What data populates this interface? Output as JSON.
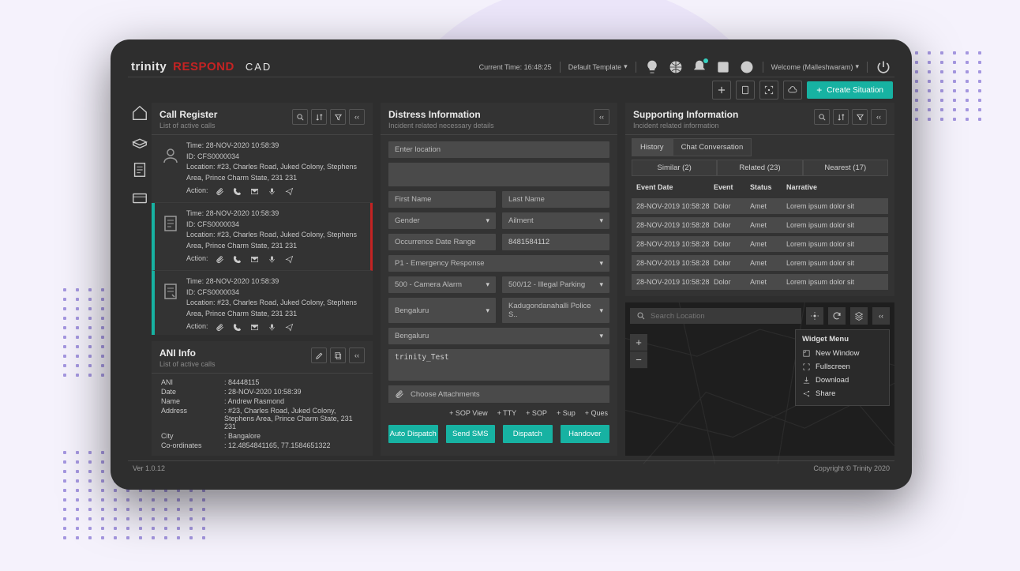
{
  "brand": {
    "part1": "trinity",
    "part2": "RESPOND",
    "part3": "CAD"
  },
  "topbar": {
    "current_time_label": "Current Time: 16:48:25",
    "template_label": "Default Template",
    "welcome": "Welcome (Malleshwaram)"
  },
  "secbar": {
    "create_label": "Create Situation"
  },
  "sidenav": {
    "items": [
      "home",
      "scan",
      "document",
      "card"
    ]
  },
  "call_register": {
    "title": "Call Register",
    "subtitle": "List of active calls",
    "cards": [
      {
        "time": "Time: 28-NOV-2020 10:58:39",
        "id": "ID: CFS0000034",
        "loc": "Location: #23, Charles Road, Juked Colony, Stephens Area, Prince Charm State, 231 231",
        "action_label": "Action:"
      },
      {
        "time": "Time: 28-NOV-2020 10:58:39",
        "id": "ID: CFS0000034",
        "loc": "Location: #23, Charles Road, Juked Colony, Stephens Area, Prince Charm State, 231 231",
        "action_label": "Action:"
      },
      {
        "time": "Time: 28-NOV-2020 10:58:39",
        "id": "ID: CFS0000034",
        "loc": "Location: #23, Charles Road, Juked Colony, Stephens Area, Prince Charm State, 231 231",
        "action_label": "Action:"
      }
    ]
  },
  "ani": {
    "title": "ANI Info",
    "subtitle": "List of active calls",
    "fields": {
      "ani_k": "ANI",
      "ani_v": ": 84448115",
      "date_k": "Date",
      "date_v": ": 28-NOV-2020 10:58:39",
      "name_k": "Name",
      "name_v": ": Andrew Rasmond",
      "addr_k": "Address",
      "addr_v": ": #23, Charles Road, Juked Colony, Stephens Area, Prince Charm State, 231 231",
      "city_k": "City",
      "city_v": ": Bangalore",
      "coord_k": "Co-ordinates",
      "coord_v": ": 12.4854841165, 77.1584651322"
    }
  },
  "distress": {
    "title": "Distress Information",
    "subtitle": "Incident related necessary details",
    "location_ph": "Enter location",
    "first_name_ph": "First Name",
    "last_name_ph": "Last Name",
    "gender": "Gender",
    "ailment": "Ailment",
    "odr_ph": "Occurrence Date Range",
    "phone": "8481584112",
    "priority": "P1 - Emergency Response",
    "evt1": "500 - Camera Alarm",
    "evt2": "500/12 - Illegal Parking",
    "city": "Bengaluru",
    "station": "Kadugondanahalli Police S..",
    "area": "Bengaluru",
    "notes": "trinity_Test",
    "attach_label": "Choose Attachments",
    "links": {
      "sopview": "+ SOP View",
      "tty": "+ TTY",
      "sop": "+ SOP",
      "sup": "+ Sup",
      "ques": "+ Ques"
    },
    "buttons": {
      "autodispatch": "Auto Dispatch",
      "sms": "Send SMS",
      "dispatch": "Dispatch",
      "handover": "Handover"
    }
  },
  "supporting": {
    "title": "Supporting Information",
    "subtitle": "Incident related information",
    "tabs": {
      "history": "History",
      "chat": "Chat Conversation"
    },
    "subtabs": {
      "similar": "Similar (2)",
      "related": "Related (23)",
      "nearest": "Nearest (17)"
    },
    "columns": {
      "c1": "Event Date",
      "c2": "Event",
      "c3": "Status",
      "c4": "Narrative"
    },
    "rows": [
      {
        "d": "28-NOV-2019 10:58:28",
        "e": "Dolor",
        "s": "Amet",
        "n": "Lorem ipsum dolor sit"
      },
      {
        "d": "28-NOV-2019 10:58:28",
        "e": "Dolor",
        "s": "Amet",
        "n": "Lorem ipsum dolor sit"
      },
      {
        "d": "28-NOV-2019 10:58:28",
        "e": "Dolor",
        "s": "Amet",
        "n": "Lorem ipsum dolor sit"
      },
      {
        "d": "28-NOV-2019 10:58:28",
        "e": "Dolor",
        "s": "Amet",
        "n": "Lorem ipsum dolor sit"
      },
      {
        "d": "28-NOV-2019 10:58:28",
        "e": "Dolor",
        "s": "Amet",
        "n": "Lorem ipsum dolor sit"
      }
    ]
  },
  "map": {
    "search_ph": "Search Location",
    "widget": {
      "title": "Widget Menu",
      "items": {
        "nw": "New Window",
        "fs": "Fullscreen",
        "dl": "Download",
        "sh": "Share"
      }
    }
  },
  "footer": {
    "ver": "Ver 1.0.12",
    "copy": "Copyright © Trinity 2020"
  }
}
